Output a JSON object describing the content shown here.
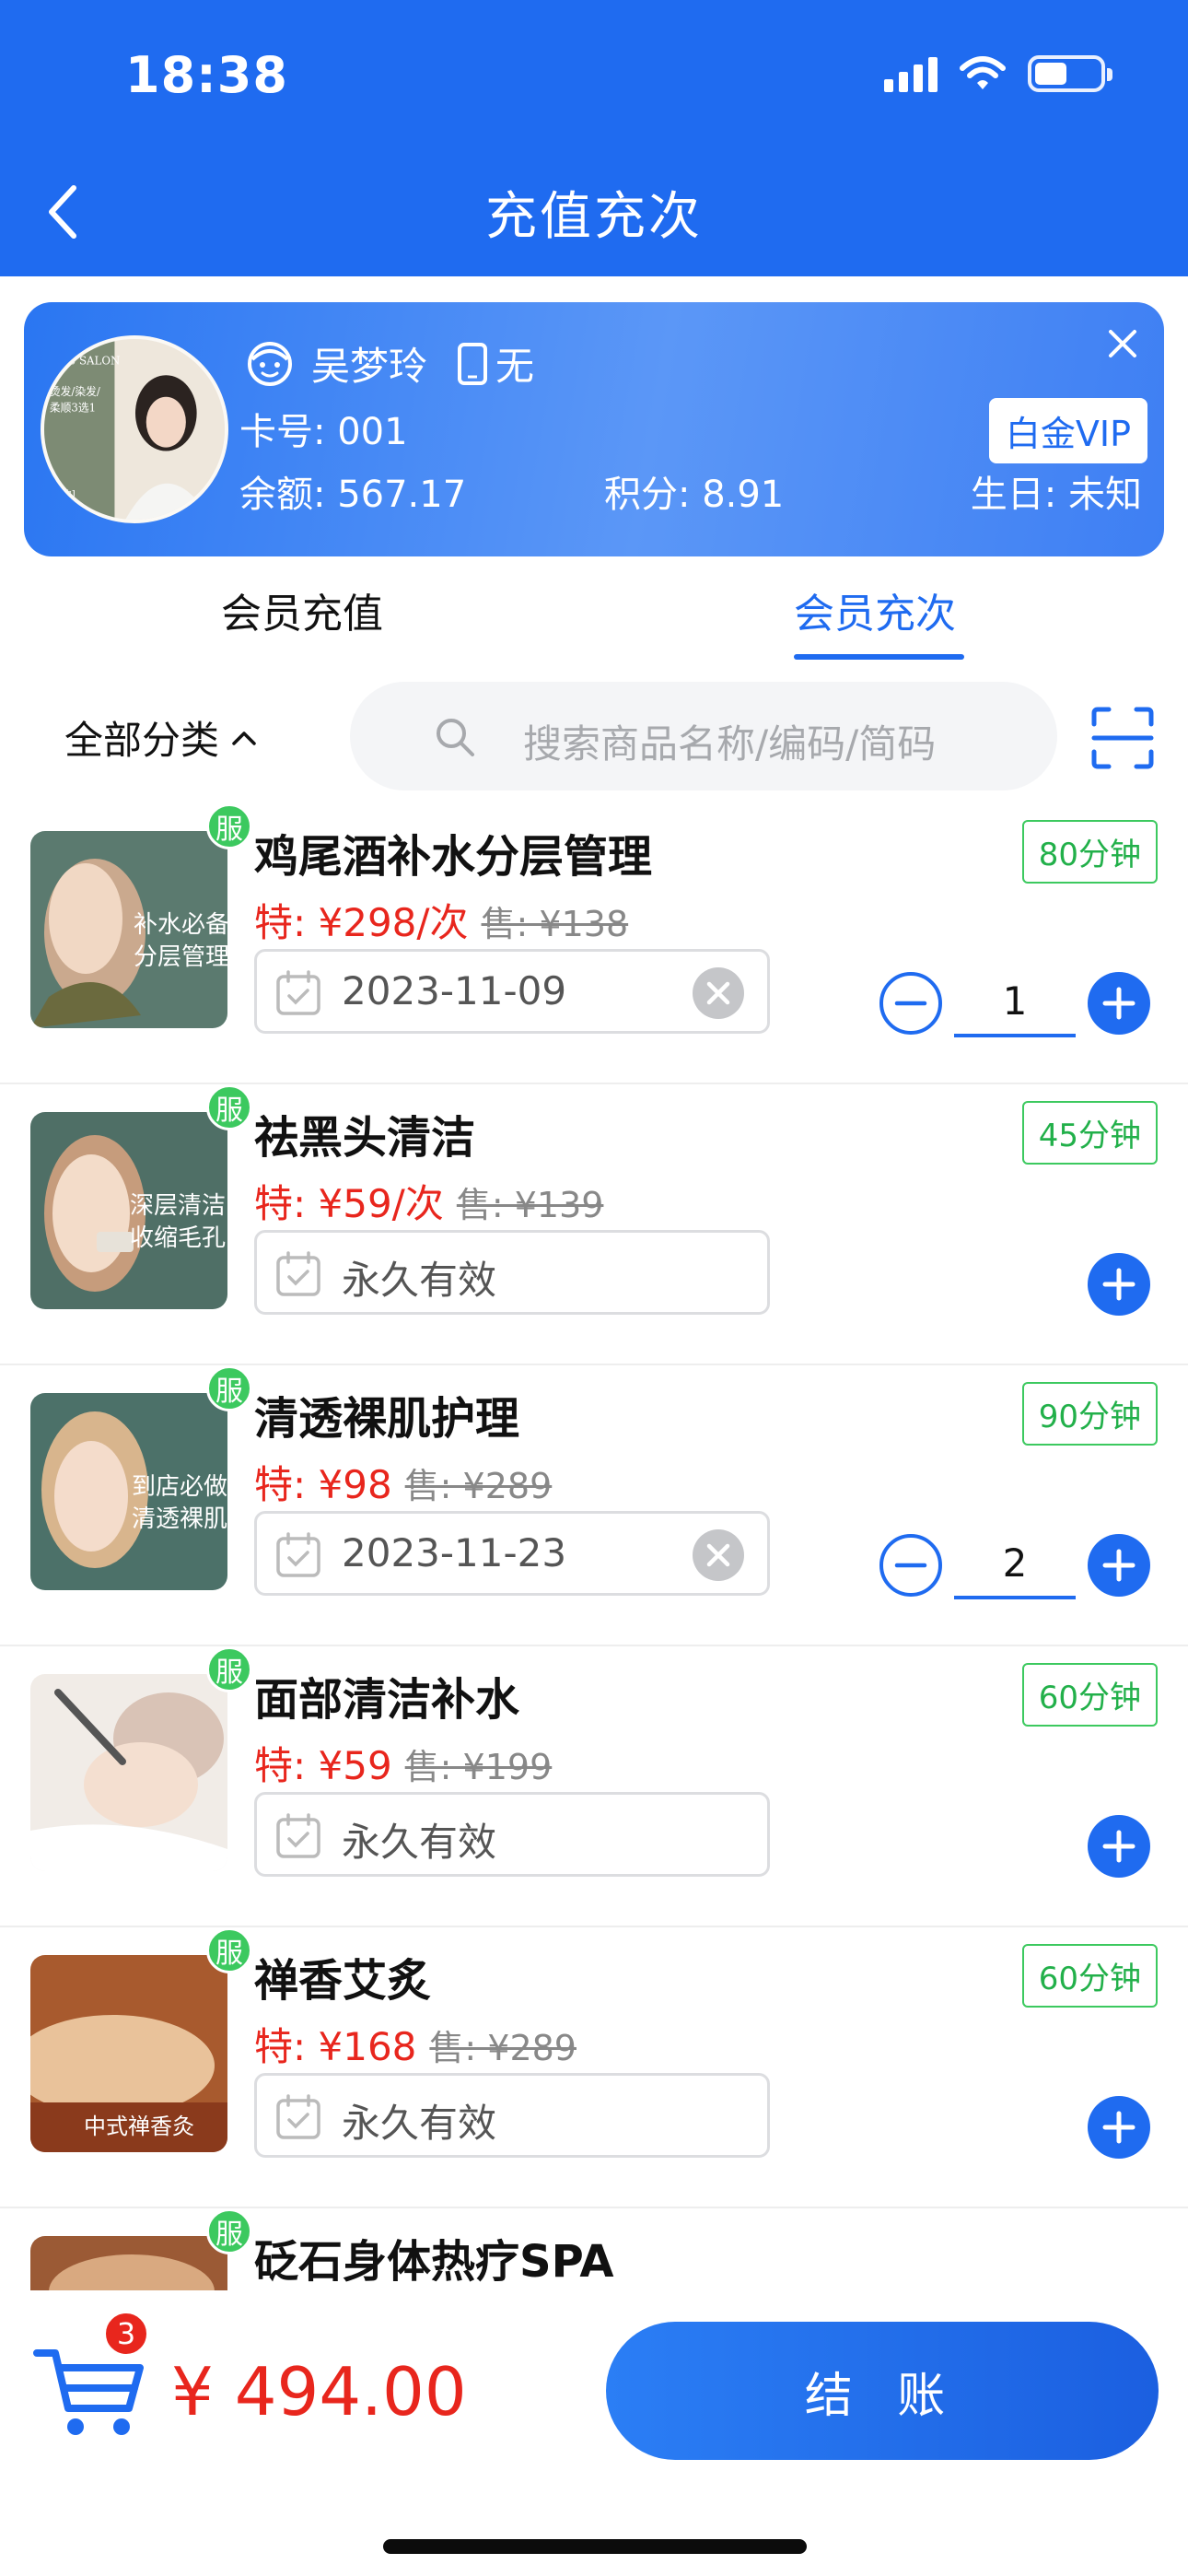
{
  "status_bar": {
    "time": "18:38"
  },
  "header": {
    "title": "充值充次"
  },
  "member": {
    "name": "吴梦玲",
    "phone": "无",
    "card_no": "卡号: 001",
    "balance": "余额: 567.17",
    "points": "积分: 8.91",
    "birthday": "生日: 未知",
    "level": "白金VIP",
    "avatar_text": [
      "Y·10 SALON",
      "烫发/染发/",
      "柔顺3选1",
      "[爆款]"
    ]
  },
  "tabs": [
    {
      "label": "会员充值",
      "active": false
    },
    {
      "label": "会员充次",
      "active": true
    }
  ],
  "filter": {
    "category": "全部分类",
    "search_placeholder": "搜索商品名称/编码/简码"
  },
  "products": [
    {
      "badge": "服",
      "name": "鸡尾酒补水分层管理",
      "duration": "80分钟",
      "special_price": "特: ¥298/次",
      "original_price": "售: ¥138",
      "validity": "2023-11-09",
      "quantity": "1",
      "thumb_text": "补水必备 分层管理",
      "thumb_colors": [
        "#5b7a6f",
        "#c9b9a6"
      ]
    },
    {
      "badge": "服",
      "name": "祛黑头清洁",
      "duration": "45分钟",
      "special_price": "特: ¥59/次",
      "original_price": "售: ¥139",
      "validity": "永久有效",
      "quantity": null,
      "thumb_text": "深层清洁 收缩毛孔",
      "thumb_colors": [
        "#4f6f66",
        "#d8c4b0"
      ]
    },
    {
      "badge": "服",
      "name": "清透裸肌护理",
      "duration": "90分钟",
      "special_price": "特: ¥98",
      "original_price": "售: ¥289",
      "validity": "2023-11-23",
      "quantity": "2",
      "thumb_text": "到店必做 清透裸肌",
      "thumb_colors": [
        "#4c7169",
        "#cbb8a0"
      ]
    },
    {
      "badge": "服",
      "name": "面部清洁补水",
      "duration": "60分钟",
      "special_price": "特: ¥59",
      "original_price": "售: ¥199",
      "validity": "永久有效",
      "quantity": null,
      "thumb_text": "",
      "thumb_colors": [
        "#f1ece7",
        "#d9c3b6"
      ]
    },
    {
      "badge": "服",
      "name": "禅香艾炙",
      "duration": "60分钟",
      "special_price": "特: ¥168",
      "original_price": "售: ¥289",
      "validity": "永久有效",
      "quantity": null,
      "thumb_text": "中式禅香灸",
      "thumb_colors": [
        "#a85a2e",
        "#e9c29a"
      ]
    },
    {
      "badge": "服",
      "name": "砭石身体热疗SPA",
      "thumb_colors": [
        "#9b5a35",
        "#d9a980"
      ]
    }
  ],
  "cart": {
    "count": "3",
    "total": "¥ 494.00"
  },
  "checkout_label": "结 账",
  "colors": {
    "primary": "#1f6bf0",
    "price_red": "#e8261d",
    "success_green": "#3cc95f"
  }
}
